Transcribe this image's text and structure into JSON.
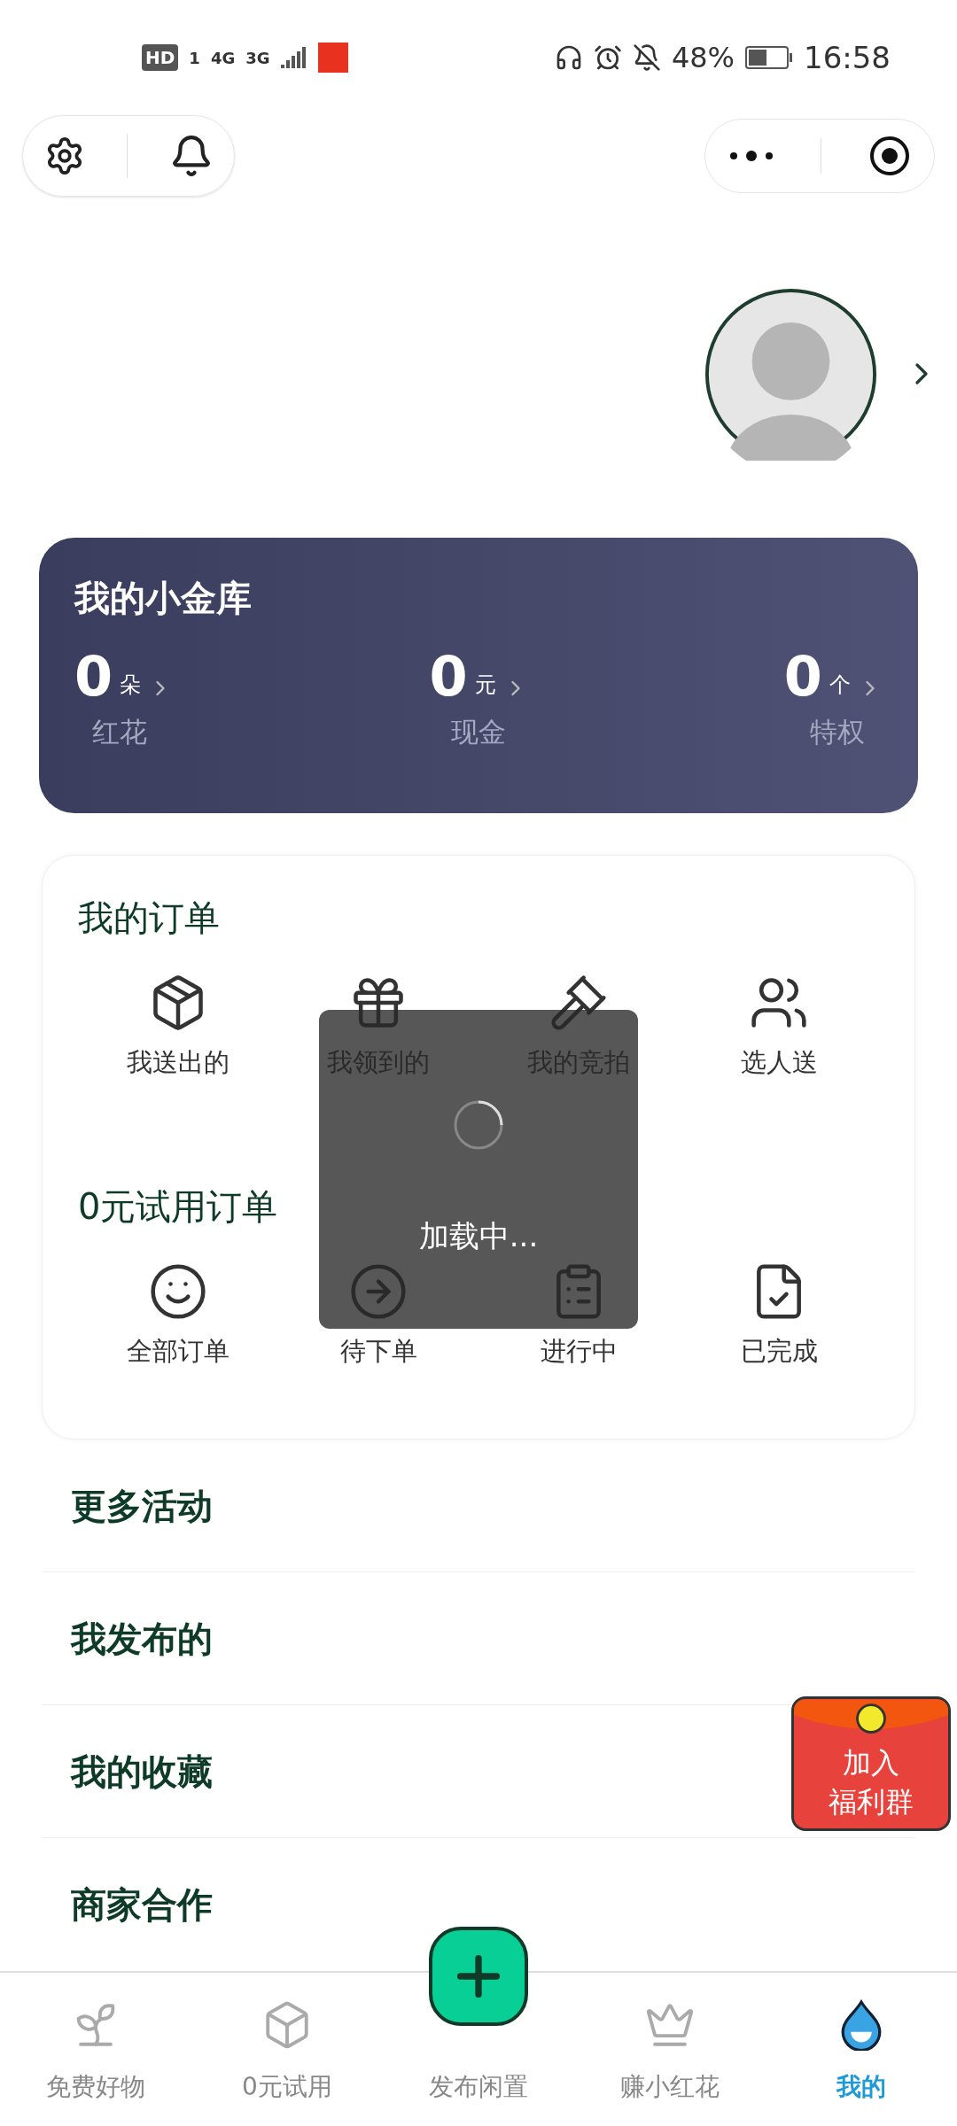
{
  "status_bar": {
    "indicators": [
      "HD",
      "1",
      "4G",
      "3G"
    ],
    "battery": "48%",
    "time": "16:58"
  },
  "wallet": {
    "title": "我的小金库",
    "stats": [
      {
        "value": "0",
        "unit": "朵",
        "label": "红花"
      },
      {
        "value": "0",
        "unit": "元",
        "label": "现金"
      },
      {
        "value": "0",
        "unit": "个",
        "label": "特权"
      }
    ]
  },
  "orders": {
    "title": "我的订单",
    "items": [
      {
        "label": "我送出的"
      },
      {
        "label": "我领到的"
      },
      {
        "label": "我的竞拍"
      },
      {
        "label": "选人送"
      }
    ]
  },
  "trial_orders": {
    "title": "0元试用订单",
    "items": [
      {
        "label": "全部订单"
      },
      {
        "label": "待下单"
      },
      {
        "label": "进行中"
      },
      {
        "label": "已完成"
      }
    ]
  },
  "menu": [
    {
      "label": "更多活动"
    },
    {
      "label": "我发布的"
    },
    {
      "label": "我的收藏"
    },
    {
      "label": "商家合作"
    }
  ],
  "promo": {
    "lines": [
      "加入",
      "福利群"
    ]
  },
  "loading": {
    "text": "加载中..."
  },
  "tab_bar": [
    {
      "label": "免费好物",
      "selected": false
    },
    {
      "label": "0元试用",
      "selected": false
    },
    {
      "label": "发布闲置",
      "selected": false
    },
    {
      "label": "赚小红花",
      "selected": false
    },
    {
      "label": "我的",
      "selected": true
    }
  ]
}
